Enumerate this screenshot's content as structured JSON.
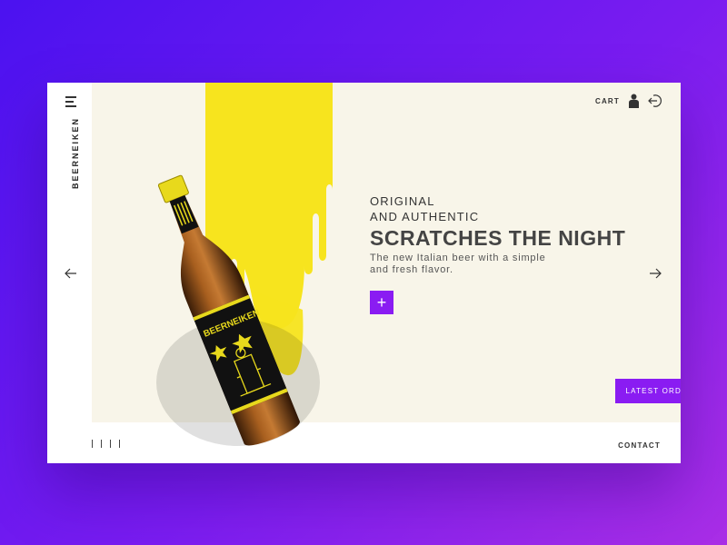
{
  "brand": {
    "name": "BEERNEIKEN"
  },
  "nav": {
    "cart_label": "CART"
  },
  "hero": {
    "eyebrow_line1": "ORIGINAL",
    "eyebrow_line2": "AND AUTHENTIC",
    "headline": "SCRATCHES THE NIGHT",
    "description": "The new Italian beer with a simple and fresh flavor.",
    "plus_label": "+",
    "cta_label": "LATEST ORDER"
  },
  "product": {
    "label_text": "BEERNEIKEN"
  },
  "footer": {
    "contact_label": "CONTACT",
    "pager_count": 4
  },
  "colors": {
    "accent": "#8a1cf2",
    "yellow": "#f7e41e",
    "cream": "#f8f5e9"
  },
  "icons": [
    "menu-icon",
    "user-icon",
    "logout-icon",
    "arrow-left-icon",
    "arrow-right-icon"
  ]
}
